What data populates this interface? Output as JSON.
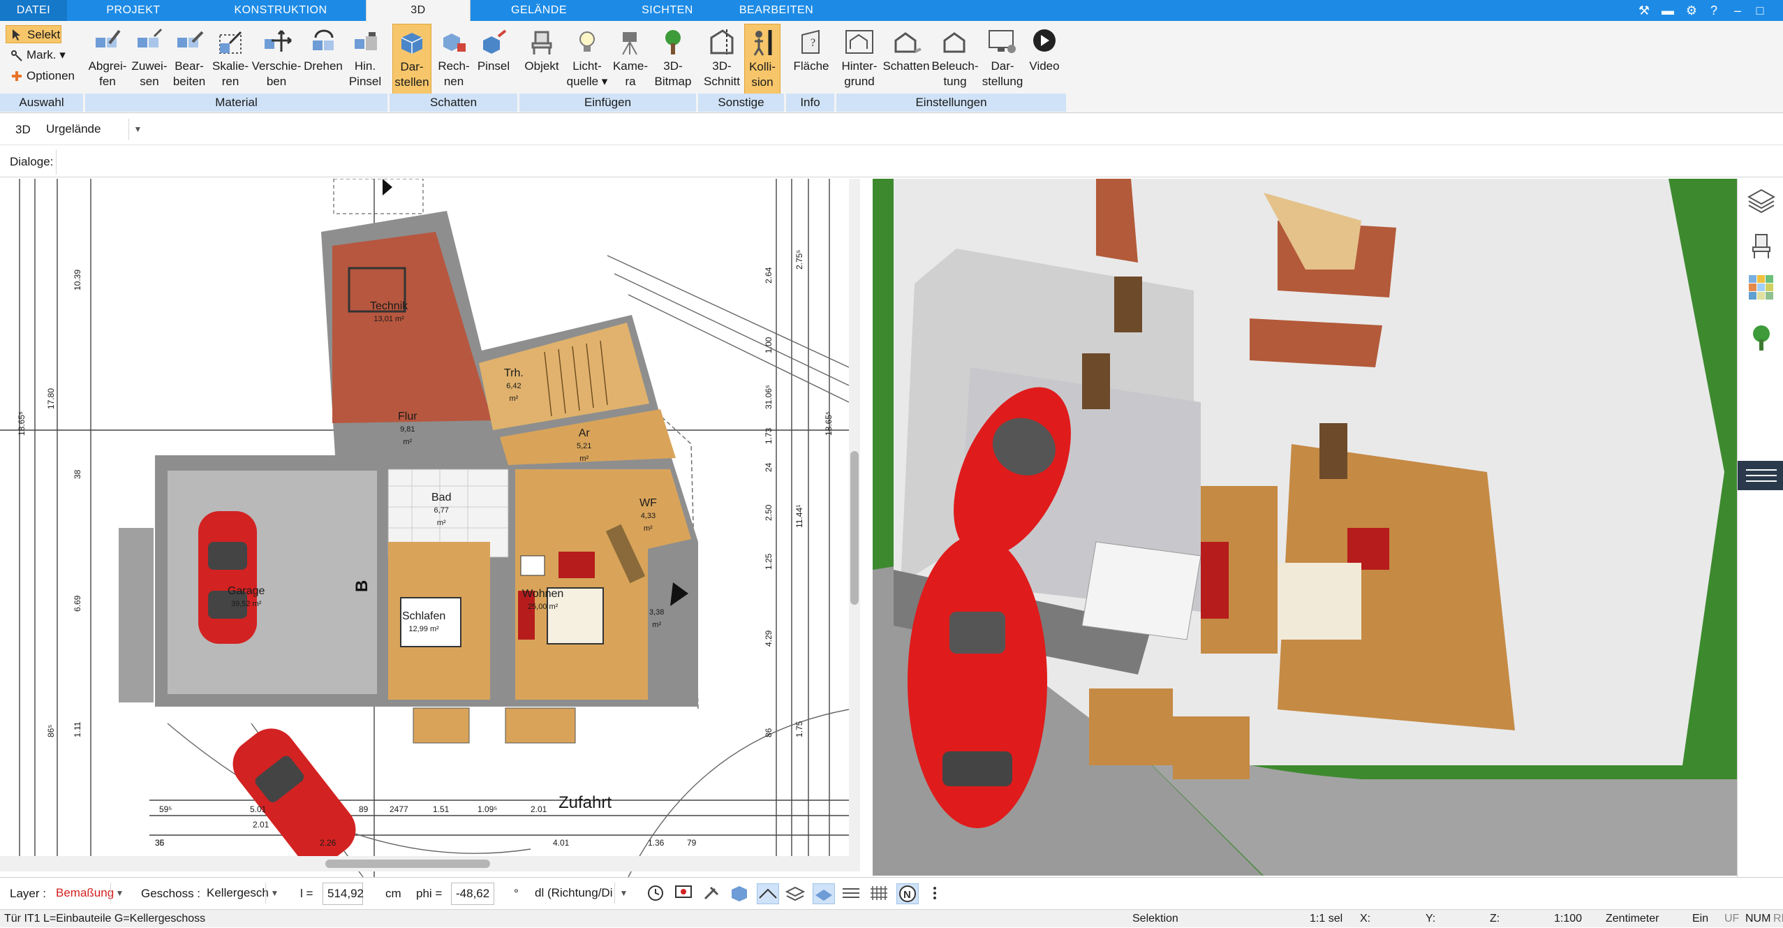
{
  "menu": {
    "tabs": [
      "DATEI",
      "PROJEKT",
      "KONSTRUKTION",
      "3D",
      "GELÄNDE",
      "SICHTEN",
      "BEARBEITEN"
    ],
    "active_tab": "3D"
  },
  "ribbon": {
    "auswahl": {
      "select": "Selekt",
      "mark": "Mark.",
      "options": "Optionen",
      "label": "Auswahl"
    },
    "groups": [
      "Material",
      "Schatten",
      "Einfügen",
      "Sonstige",
      "Info",
      "Einstellungen"
    ],
    "buttons": {
      "abgreifen": [
        "Abgrei-",
        "fen"
      ],
      "zuweisen": [
        "Zuwei-",
        "sen"
      ],
      "bearbeiten": [
        "Bear-",
        "beiten"
      ],
      "skalieren": [
        "Skalie-",
        "ren"
      ],
      "verschieben": [
        "Verschie-",
        "ben"
      ],
      "drehen": [
        "Drehen",
        ""
      ],
      "hinpinsel": [
        "Hin.",
        "Pinsel"
      ],
      "darstellen": [
        "Dar-",
        "stellen"
      ],
      "rechnen": [
        "Rech-",
        "nen"
      ],
      "pinsel": [
        "Pinsel",
        ""
      ],
      "objekt": [
        "Objekt",
        ""
      ],
      "lichtquelle": [
        "Licht-",
        "quelle"
      ],
      "kamera": [
        "Kame-",
        "ra"
      ],
      "bitmap": [
        "3D-",
        "Bitmap"
      ],
      "schnitt": [
        "3D-",
        "Schnitt"
      ],
      "kollision": [
        "Kolli-",
        "sion"
      ],
      "flaeche": [
        "Fläche",
        ""
      ],
      "hintergrund": [
        "Hinter-",
        "grund"
      ],
      "schatten": [
        "Schatten",
        ""
      ],
      "beleuchtung": [
        "Beleuch-",
        "tung"
      ],
      "darstellung": [
        "Dar-",
        "stellung"
      ],
      "video": [
        "Video",
        ""
      ]
    }
  },
  "view_row": {
    "mode": "3D",
    "terrain": "Urgelände"
  },
  "dialog_row": {
    "label": "Dialoge:"
  },
  "plan": {
    "rooms": [
      {
        "name": "Technik",
        "area": "13,01 m²"
      },
      {
        "name": "Trh.",
        "area": "6,42 m²"
      },
      {
        "name": "Flur",
        "area": "9,81 m²"
      },
      {
        "name": "Ar",
        "area": "5,21 m²"
      },
      {
        "name": "Bad",
        "area": "6,77 m²"
      },
      {
        "name": "WF",
        "area": "4,33 m²"
      },
      {
        "name": "Garage",
        "area": "39,52 m²"
      },
      {
        "name": "Wohnen",
        "area": "25,00 m²"
      },
      {
        "name": "Schlafen",
        "area": "12,99 m²"
      },
      {
        "name": "",
        "area": "3,38 m²"
      }
    ],
    "street": "Zufahrt",
    "section_mark": "B",
    "dims_left": [
      "10.39",
      "17.80",
      "18.65⁵",
      "38",
      "6.69",
      "86⁵",
      "1.11"
    ],
    "dims_right": [
      "2.64",
      "2.75⁵",
      "1.00",
      "31.06⁵",
      "18.65⁵",
      "1.73",
      "24",
      "2.50",
      "11.44¹",
      "1.25",
      "4.29",
      "86",
      "1.75"
    ],
    "dims_bottom": [
      "59⁵",
      "5.01",
      "2.01",
      "89",
      "2477",
      "1.51",
      "1.09⁵",
      "2.01",
      "35",
      "36",
      "2.26",
      "4.01",
      "1.36",
      "79"
    ]
  },
  "bottom": {
    "layer_label": "Layer :",
    "layer_value": "Bemaßung",
    "floor_label": "Geschoss :",
    "floor_value": "Kellergesch",
    "l_label": "l =",
    "l_value": "514,92",
    "l_unit": "cm",
    "phi_label": "phi =",
    "phi_value": "-48,62",
    "phi_unit": "°",
    "dl_value": "dl (Richtung/Di"
  },
  "status": {
    "hint": "Tür IT1 L=Einbauteile G=Kellergeschoss",
    "mode": "Selektion",
    "sel": "1:1 sel",
    "x": "X:",
    "y": "Y:",
    "z": "Z:",
    "scale": "1:100",
    "unit": "Zentimeter",
    "ein": "Ein",
    "uf": "UF",
    "num": "NUM",
    "rf": "RF"
  },
  "colors": {
    "accent": "#1d8be6",
    "group_band": "#cfe2f7",
    "selected": "#f7c66a",
    "wall": "#8c8c8c",
    "floor_wood": "#d9a45a",
    "tile_red": "#b7573f"
  }
}
